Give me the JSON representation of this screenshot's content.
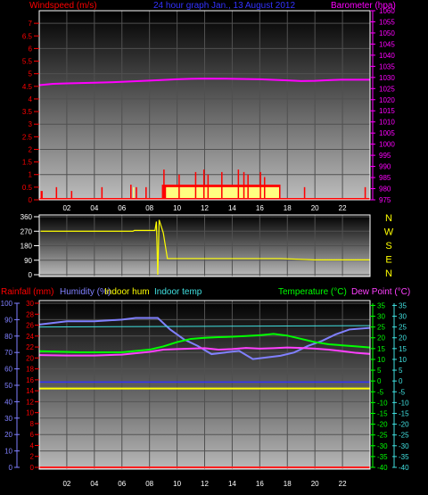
{
  "chart_data": [
    {
      "type": "line",
      "panel": "wind-barometer",
      "title": "24 hour graph Jan., 13 August 2012",
      "ylabel_left": "Windspeed (m/s)",
      "ylabel_right": "Barometer (hpa)",
      "ylim_left": [
        0,
        7.5
      ],
      "ylim_right": [
        975,
        1060
      ],
      "left_ticks": [
        "0",
        "0.5",
        "1",
        "1.5",
        "2",
        "2.5",
        "3",
        "3.5",
        "4",
        "4.5",
        "5",
        "5.5",
        "6",
        "6.5",
        "7"
      ],
      "right_ticks": [
        "975",
        "980",
        "985",
        "990",
        "995",
        "1000",
        "1005",
        "1010",
        "1015",
        "1020",
        "1025",
        "1030",
        "1035",
        "1040",
        "1045",
        "1050",
        "1055",
        "1060"
      ],
      "xlim": [
        0,
        24
      ],
      "x_ticks": [
        "02",
        "04",
        "06",
        "08",
        "10",
        "12",
        "14",
        "16",
        "18",
        "20",
        "22"
      ],
      "grid": true,
      "series": [
        {
          "name": "Barometer (hpa)",
          "color": "#ff00ff",
          "axis": "right",
          "x": [
            0,
            1,
            2,
            4,
            6,
            8,
            10,
            11,
            12,
            14,
            16,
            18,
            19,
            20,
            21,
            22,
            23,
            24
          ],
          "y": [
            1026.5,
            1027.1,
            1027.3,
            1027.6,
            1028.0,
            1028.6,
            1029.2,
            1029.4,
            1029.5,
            1029.4,
            1029.2,
            1028.7,
            1028.4,
            1028.5,
            1028.8,
            1029.0,
            1029.0,
            1029.0
          ]
        }
      ],
      "wind_bars": {
        "color": "#ff0000",
        "bands": [
          {
            "x_start": 0.1,
            "x_end": 0.25,
            "value": 0.35
          },
          {
            "x_start": 1.2,
            "x_end": 1.3,
            "value": 0.5
          },
          {
            "x_start": 2.3,
            "x_end": 2.4,
            "value": 0.35
          },
          {
            "x_start": 4.5,
            "x_end": 4.6,
            "value": 0.5
          },
          {
            "x_start": 6.6,
            "x_end": 6.7,
            "value": 0.6
          },
          {
            "x_start": 7.0,
            "x_end": 7.1,
            "value": 0.5
          },
          {
            "x_start": 7.7,
            "x_end": 7.8,
            "value": 0.5
          },
          {
            "x_start": 8.9,
            "x_end": 17.5,
            "value": 0.6
          },
          {
            "x_start": 19.2,
            "x_end": 19.3,
            "value": 0.5
          },
          {
            "x_start": 23.6,
            "x_end": 23.7,
            "value": 0.5
          }
        ],
        "peaks": [
          {
            "x": 9.0,
            "value": 1.2
          },
          {
            "x": 10.1,
            "value": 1.0
          },
          {
            "x": 11.3,
            "value": 1.1
          },
          {
            "x": 11.9,
            "value": 1.2
          },
          {
            "x": 12.2,
            "value": 1.0
          },
          {
            "x": 13.2,
            "value": 1.1
          },
          {
            "x": 14.4,
            "value": 1.2
          },
          {
            "x": 14.8,
            "value": 1.1
          },
          {
            "x": 15.1,
            "value": 1.0
          },
          {
            "x": 16.0,
            "value": 1.1
          },
          {
            "x": 16.3,
            "value": 0.9
          }
        ]
      },
      "gust_bars": {
        "color": "#ffff80",
        "bands": [
          {
            "x_start": 6.8,
            "x_end": 6.9,
            "value": 0.5
          },
          {
            "x_start": 9.2,
            "x_end": 17.4,
            "value": 0.5
          }
        ]
      }
    },
    {
      "type": "line",
      "panel": "wind-direction",
      "ylim": [
        0,
        360
      ],
      "left_ticks": [
        "0",
        "90",
        "180",
        "270",
        "360"
      ],
      "direction_labels": [
        "N",
        "W",
        "S",
        "E",
        "N"
      ],
      "xlim": [
        0,
        24
      ],
      "series": [
        {
          "name": "Wind direction",
          "color": "#ffff00",
          "x": [
            0.1,
            6.8,
            6.9,
            7.5,
            8.4,
            8.5,
            8.6,
            8.7,
            9.0,
            9.3,
            10.0,
            11.0,
            12.0,
            14.0,
            15.5,
            16.0,
            17.0,
            17.5,
            20.0,
            24.0
          ],
          "y": [
            270,
            270,
            275,
            275,
            275,
            330,
            0,
            340,
            260,
            100,
            100,
            100,
            100,
            100,
            100,
            100,
            100,
            100,
            92,
            92
          ]
        }
      ]
    },
    {
      "type": "line",
      "panel": "temperature-humidity",
      "legend_left": [
        "Rainfall (mm)",
        "Humidity (%)",
        "Indoor hum",
        "Indoor temp"
      ],
      "legend_right": [
        "Temperature (°C)",
        "Dew Point (°C)"
      ],
      "humidity_ticks": [
        "0",
        "10",
        "20",
        "30",
        "40",
        "50",
        "60",
        "70",
        "80",
        "90",
        "100"
      ],
      "rainfall_ticks": [
        "0",
        "2",
        "4",
        "6",
        "8",
        "10",
        "12",
        "14",
        "16",
        "18",
        "20",
        "22",
        "24",
        "26",
        "28",
        "30"
      ],
      "temp_ticks": [
        "-40",
        "-35",
        "-30",
        "-25",
        "-20",
        "-15",
        "-10",
        "-5",
        "0",
        "5",
        "10",
        "15",
        "20",
        "25",
        "30",
        "35"
      ],
      "ylim_humidity": [
        0,
        100
      ],
      "ylim_temp": [
        -40,
        36
      ],
      "xlim": [
        0,
        24
      ],
      "x_ticks": [
        "02",
        "04",
        "06",
        "08",
        "10",
        "12",
        "14",
        "16",
        "18",
        "20",
        "22"
      ],
      "series": [
        {
          "name": "Humidity (%)",
          "color": "#8080ff",
          "axis": "humidity",
          "x": [
            0,
            2,
            4,
            6,
            7,
            8,
            8.6,
            9.5,
            10.5,
            11.5,
            12.5,
            13.5,
            14.5,
            15.5,
            16.5,
            17.5,
            18.5,
            19.5,
            20.5,
            21.5,
            22.5,
            24
          ],
          "y": [
            87,
            89,
            89,
            90,
            91,
            91,
            91,
            84,
            78,
            74,
            69,
            70,
            71,
            66,
            67,
            68,
            70,
            74,
            77,
            81,
            84,
            85
          ]
        },
        {
          "name": "Indoor hum",
          "color": "#ffff00",
          "axis": "humidity",
          "x": [
            0,
            2,
            4,
            6,
            8,
            10,
            12,
            14,
            16,
            18,
            20,
            22,
            24
          ],
          "y": [
            48,
            48,
            48,
            48,
            48,
            48,
            48,
            48,
            48,
            48,
            48,
            48,
            48
          ]
        },
        {
          "name": "Indoor temp",
          "color": "#40e0e0",
          "axis": "temp",
          "x": [
            0,
            4,
            8,
            12,
            16,
            20,
            24
          ],
          "y": [
            25.0,
            25.1,
            25.2,
            25.3,
            25.4,
            25.5,
            25.6
          ]
        },
        {
          "name": "Rainfall (mm)",
          "color": "#ff2020",
          "axis": "humidity",
          "x": [
            0,
            24
          ],
          "y": [
            0,
            0
          ]
        },
        {
          "name": "Temperature (°C)",
          "color": "#00ff00",
          "axis": "temp",
          "x": [
            0,
            3,
            6,
            8,
            9,
            10,
            11,
            12,
            13,
            14,
            15,
            16,
            17,
            18,
            19,
            20,
            21,
            22,
            23,
            24
          ],
          "y": [
            13.8,
            13.3,
            13.3,
            14.5,
            16.0,
            18.0,
            19.5,
            20.0,
            20.3,
            20.5,
            20.8,
            21.2,
            21.8,
            21.0,
            19.5,
            18.0,
            17.0,
            16.5,
            16.0,
            15.5
          ]
        },
        {
          "name": "Dew Point (°C)",
          "color": "#ff40ff",
          "axis": "temp",
          "x": [
            0,
            2,
            4,
            6,
            8,
            9,
            10,
            11,
            12,
            13,
            14,
            15,
            16,
            17,
            18,
            19,
            20,
            21,
            22,
            23,
            24
          ],
          "y": [
            12.0,
            11.8,
            11.8,
            12.2,
            13.5,
            14.5,
            14.8,
            15.0,
            15.2,
            14.5,
            14.8,
            15.3,
            15.0,
            15.2,
            15.5,
            15.3,
            15.0,
            14.5,
            13.8,
            13.0,
            12.5
          ]
        }
      ]
    }
  ],
  "colors": {
    "bg": "#000000",
    "panel_top": "#000000",
    "panel_bottom": "#b8b8b8",
    "axis": "#ffffff",
    "red": "#ff0000",
    "magenta": "#ff00ff",
    "blue": "#3232ff",
    "yellow": "#ffff00",
    "green": "#00ff00",
    "cyan": "#40e0e0",
    "grid": "#505050"
  }
}
